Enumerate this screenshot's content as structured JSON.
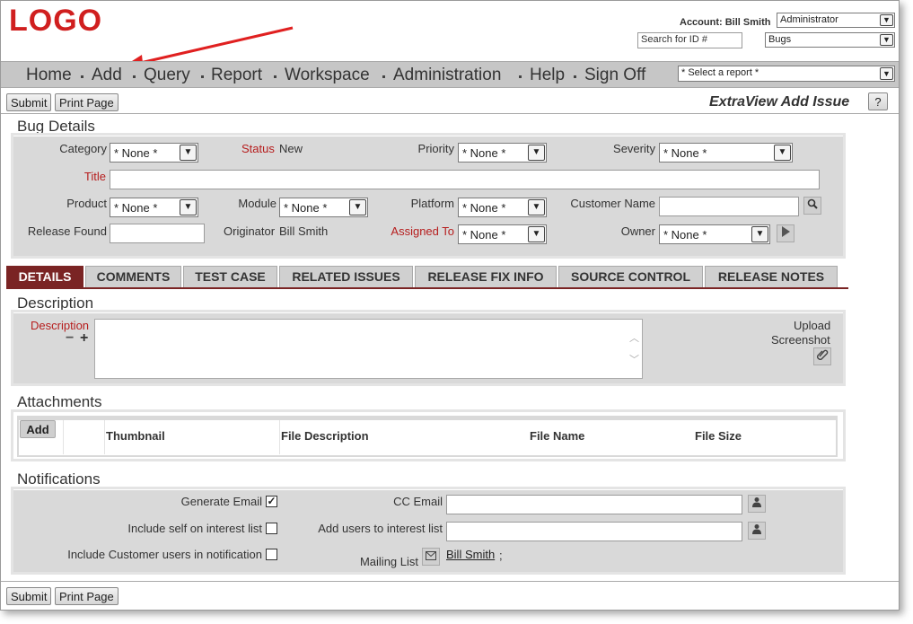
{
  "header": {
    "logo": "LOGO",
    "account_label": "Account:",
    "account_name": "Bill Smith",
    "role_select": "Administrator",
    "search_placeholder": "Search for ID #",
    "area_select": "Bugs",
    "report_select": "* Select a report *"
  },
  "nav": [
    "Home",
    "Add",
    "Query",
    "Report",
    "Workspace",
    "Administration",
    "Help",
    "Sign Off"
  ],
  "toolbar": {
    "submit": "Submit",
    "print": "Print Page",
    "page_title": "ExtraView Add Issue",
    "help": "?"
  },
  "bug_details": {
    "title": "Bug Details",
    "category_label": "Category",
    "category_value": "* None *",
    "status_label": "Status",
    "status_value": "New",
    "priority_label": "Priority",
    "priority_value": "* None *",
    "severity_label": "Severity",
    "severity_value": "* None *",
    "title_label": "Title",
    "product_label": "Product",
    "product_value": "* None *",
    "module_label": "Module",
    "module_value": "* None *",
    "platform_label": "Platform",
    "platform_value": "* None *",
    "customer_label": "Customer Name",
    "release_label": "Release Found",
    "originator_label": "Originator",
    "originator_value": "Bill Smith",
    "assigned_label": "Assigned To",
    "assigned_value": "* None *",
    "owner_label": "Owner",
    "owner_value": "* None *"
  },
  "tabs": [
    "DETAILS",
    "COMMENTS",
    "TEST CASE",
    "RELATED ISSUES",
    "RELEASE FIX INFO",
    "SOURCE CONTROL",
    "RELEASE NOTES"
  ],
  "description": {
    "title": "Description",
    "label": "Description",
    "minus": "−",
    "plus": "+",
    "upload_line1": "Upload",
    "upload_line2": "Screenshot"
  },
  "attachments": {
    "title": "Attachments",
    "add": "Add",
    "columns": [
      "Thumbnail",
      "File Description",
      "File Name",
      "File Size"
    ]
  },
  "notifications": {
    "title": "Notifications",
    "generate_email": "Generate Email",
    "include_self": "Include self on interest list",
    "include_customer": "Include Customer users in notification",
    "cc_email": "CC Email",
    "add_users": "Add users to interest list",
    "mailing_list": "Mailing List",
    "mailing_user": "Bill Smith",
    "mailing_sep": ";",
    "checkmark": "✓"
  },
  "footer": {
    "submit": "Submit",
    "print": "Print Page"
  },
  "colors": {
    "logo": "#d01f1f",
    "active_tab": "#7a2424",
    "required_label": "#b61d1d",
    "arrow": "#e02020"
  }
}
